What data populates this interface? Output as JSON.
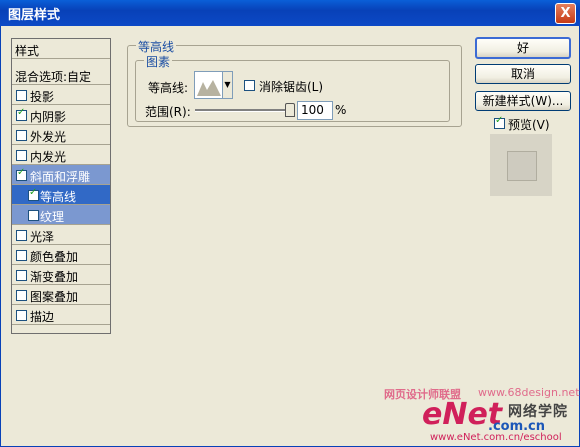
{
  "window": {
    "title": "图层样式",
    "close_label": "X"
  },
  "style_list": {
    "header": "样式",
    "blend_options": "混合选项:自定",
    "items": [
      {
        "label": "投影",
        "checked": false
      },
      {
        "label": "内阴影",
        "checked": true
      },
      {
        "label": "外发光",
        "checked": false
      },
      {
        "label": "内发光",
        "checked": false
      },
      {
        "label": "斜面和浮雕",
        "checked": true
      },
      {
        "label": "等高线",
        "checked": true
      },
      {
        "label": "纹理",
        "checked": false
      },
      {
        "label": "光泽",
        "checked": false
      },
      {
        "label": "颜色叠加",
        "checked": false
      },
      {
        "label": "渐变叠加",
        "checked": false
      },
      {
        "label": "图案叠加",
        "checked": false
      },
      {
        "label": "描边",
        "checked": false
      }
    ]
  },
  "contour_panel": {
    "group_title": "等高线",
    "subgroup_title": "图素",
    "contour_label": "等高线:",
    "antialias_label": "消除锯齿(L)",
    "range_label": "范围(R):",
    "range_value": "100",
    "range_unit": "%",
    "range_fraction": 1.0
  },
  "buttons": {
    "ok": "好",
    "cancel": "取消",
    "new_style": "新建样式(W)..."
  },
  "preview": {
    "label": "预览(V)",
    "checked": true
  },
  "watermark": {
    "site": "网页设计师联盟",
    "url_top": "www.68design.net",
    "brand": "eNet",
    "brand_suffix": ".com.cn",
    "brand_cn": "网络学院",
    "url_bottom": "www.eNet.com.cn/eschool"
  }
}
